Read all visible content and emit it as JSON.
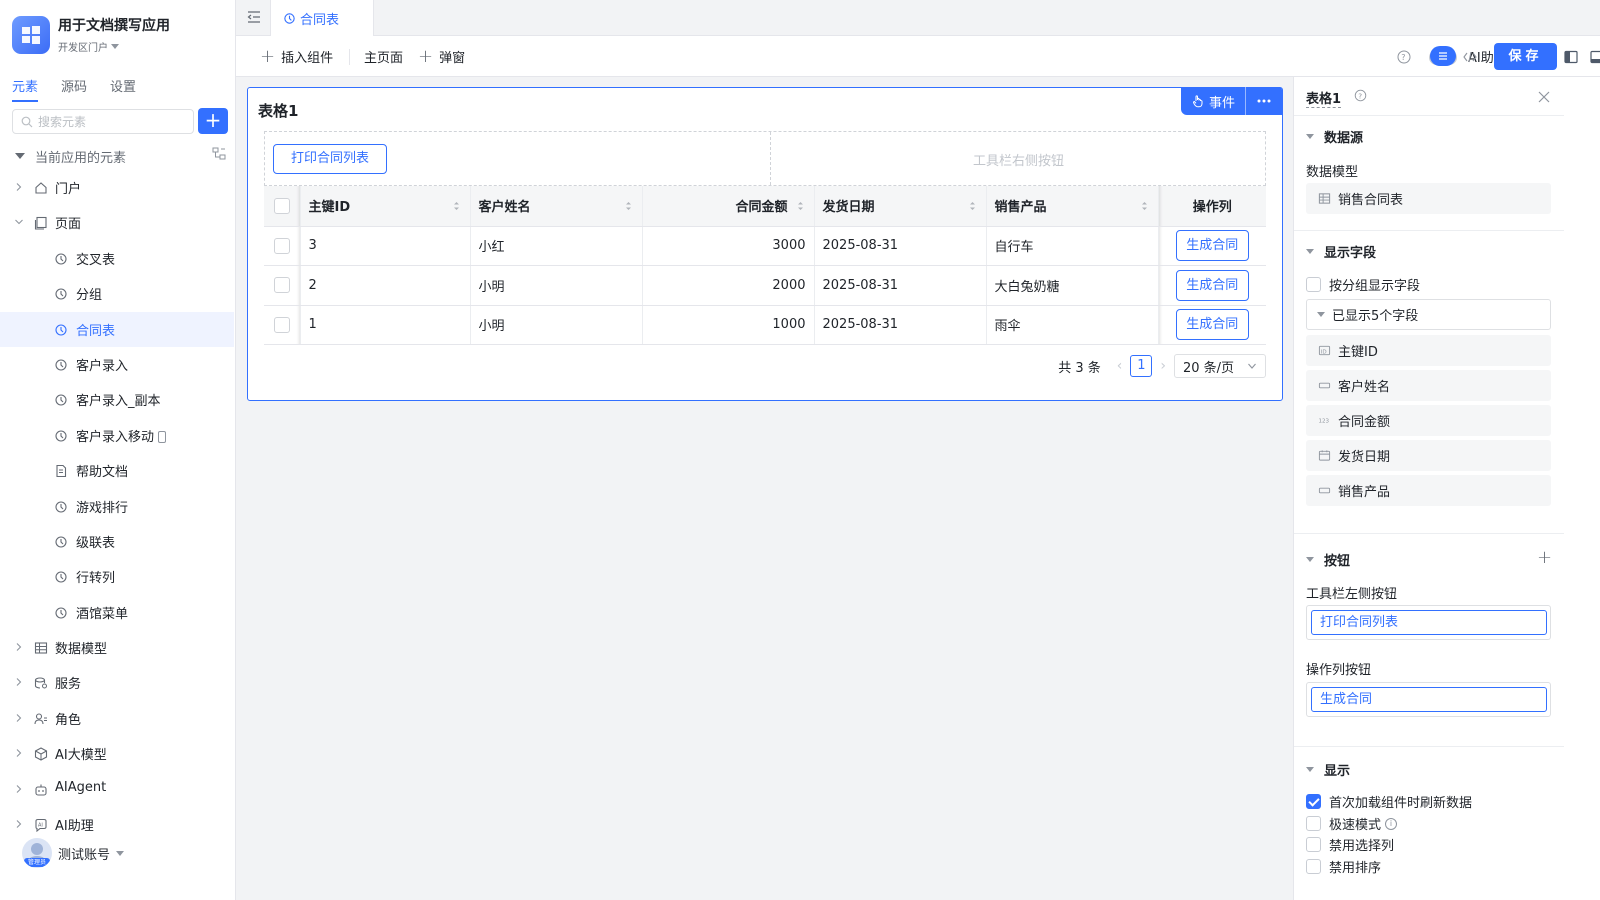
{
  "app": {
    "title": "用于文档撰写应用",
    "subtitle": "开发区门户"
  },
  "sidebar": {
    "tabs": [
      {
        "label": "元素",
        "active": true
      },
      {
        "label": "源码",
        "active": false
      },
      {
        "label": "设置",
        "active": false
      }
    ],
    "search_placeholder": "搜索元素",
    "tree_header": "当前应用的元素",
    "items": [
      {
        "label": "门户",
        "level": 1,
        "expandable": true,
        "expanded": false,
        "icon": "home-icon"
      },
      {
        "label": "页面",
        "level": 1,
        "expandable": true,
        "expanded": true,
        "icon": "pages-icon"
      },
      {
        "label": "交叉表",
        "level": 2,
        "icon": "page-icon"
      },
      {
        "label": "分组",
        "level": 2,
        "icon": "page-icon"
      },
      {
        "label": "合同表",
        "level": 2,
        "icon": "page-icon",
        "active": true
      },
      {
        "label": "客户录入",
        "level": 2,
        "icon": "page-icon"
      },
      {
        "label": "客户录入_副本",
        "level": 2,
        "icon": "page-icon"
      },
      {
        "label": "客户录入移动",
        "level": 2,
        "icon": "page-icon",
        "mobile": true
      },
      {
        "label": "帮助文档",
        "level": 2,
        "icon": "doc-icon"
      },
      {
        "label": "游戏排行",
        "level": 2,
        "icon": "page-icon"
      },
      {
        "label": "级联表",
        "level": 2,
        "icon": "page-icon"
      },
      {
        "label": "行转列",
        "level": 2,
        "icon": "page-icon"
      },
      {
        "label": "酒馆菜单",
        "level": 2,
        "icon": "page-icon"
      },
      {
        "label": "数据模型",
        "level": 1,
        "expandable": true,
        "expanded": false,
        "icon": "table-icon"
      },
      {
        "label": "服务",
        "level": 1,
        "expandable": true,
        "expanded": false,
        "icon": "service-icon"
      },
      {
        "label": "角色",
        "level": 1,
        "expandable": true,
        "expanded": false,
        "icon": "role-icon"
      },
      {
        "label": "AI大模型",
        "level": 1,
        "expandable": true,
        "expanded": false,
        "icon": "ai-model-icon"
      },
      {
        "label": "AIAgent",
        "level": 1,
        "expandable": true,
        "expanded": false,
        "icon": "robot-icon"
      },
      {
        "label": "AI助理",
        "level": 1,
        "expandable": true,
        "expanded": false,
        "icon": "ai-assistant-icon"
      }
    ],
    "account": {
      "name": "测试账号",
      "badge": "管理员"
    }
  },
  "tabbar": {
    "active_tab": "合同表"
  },
  "toolbar": {
    "insert_component": "插入组件",
    "main_page": "主页面",
    "popup": "弹窗",
    "ai_assistant": "AI助理",
    "ai_enabled": false,
    "save": "保存"
  },
  "table_component": {
    "title": "表格1",
    "event_label": "事件",
    "left_toolbar_button": "打印合同列表",
    "right_toolbar_hint": "工具栏右侧按钮",
    "columns": [
      {
        "label": "主键ID",
        "sortable": true
      },
      {
        "label": "客户姓名",
        "sortable": true
      },
      {
        "label": "合同金额",
        "sortable": true
      },
      {
        "label": "发货日期",
        "sortable": true
      },
      {
        "label": "销售产品",
        "sortable": true
      },
      {
        "label": "操作列",
        "sortable": false
      }
    ],
    "rows": [
      {
        "id": "3",
        "name": "小红",
        "amount": "3000",
        "date": "2025-08-31",
        "product": "自行车",
        "action": "生成合同"
      },
      {
        "id": "2",
        "name": "小明",
        "amount": "2000",
        "date": "2025-08-31",
        "product": "大白兔奶糖",
        "action": "生成合同"
      },
      {
        "id": "1",
        "name": "小明",
        "amount": "1000",
        "date": "2025-08-31",
        "product": "雨伞",
        "action": "生成合同"
      }
    ],
    "pager": {
      "total": "共 3 条",
      "current_page": "1",
      "page_size": "20 条/页"
    }
  },
  "props_panel": {
    "title": "表格1",
    "datasource_section": "数据源",
    "data_model_label": "数据模型",
    "data_model_value": "销售合同表",
    "fields_section": "显示字段",
    "group_fields_label": "按分组显示字段",
    "fields_summary": "已显示5个字段",
    "fields": [
      {
        "label": "主键ID",
        "icon": "id-field-icon"
      },
      {
        "label": "客户姓名",
        "icon": "text-field-icon"
      },
      {
        "label": "合同金额",
        "icon": "number-field-icon"
      },
      {
        "label": "发货日期",
        "icon": "date-field-icon"
      },
      {
        "label": "销售产品",
        "icon": "text-field-icon"
      }
    ],
    "buttons_section": "按钮",
    "toolbar_left_label": "工具栏左侧按钮",
    "toolbar_left_button": "打印合同列表",
    "action_column_label": "操作列按钮",
    "action_column_button": "生成合同",
    "display_section": "显示",
    "display_options": [
      {
        "label": "首次加载组件时刷新数据",
        "checked": true
      },
      {
        "label": "极速模式",
        "checked": false,
        "info": true
      },
      {
        "label": "禁用选择列",
        "checked": false
      },
      {
        "label": "禁用排序",
        "checked": false
      }
    ]
  },
  "colors": {
    "accent": "#3370ff",
    "text": "#1f2329",
    "muted": "#646a73"
  }
}
